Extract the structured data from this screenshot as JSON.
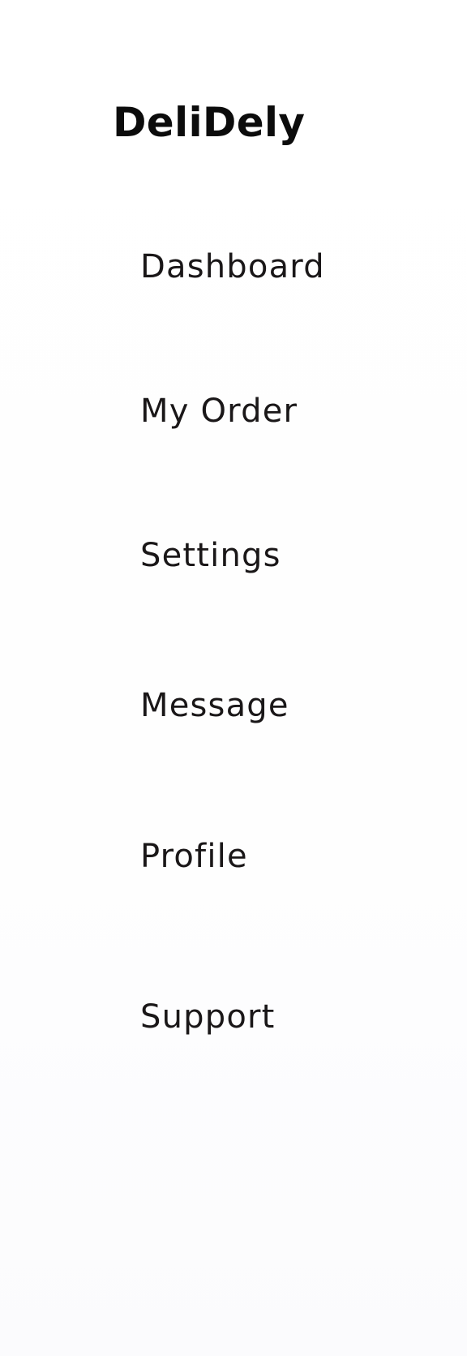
{
  "brand": {
    "name": "DeliDely"
  },
  "nav": {
    "items": [
      {
        "label": "Dashboard"
      },
      {
        "label": "My Order"
      },
      {
        "label": "Settings"
      },
      {
        "label": "Message"
      },
      {
        "label": "Profile"
      },
      {
        "label": "Support"
      }
    ]
  },
  "colors": {
    "background": "#ffffff",
    "brand_text": "#0c0c0c",
    "nav_text": "#1a1718"
  }
}
